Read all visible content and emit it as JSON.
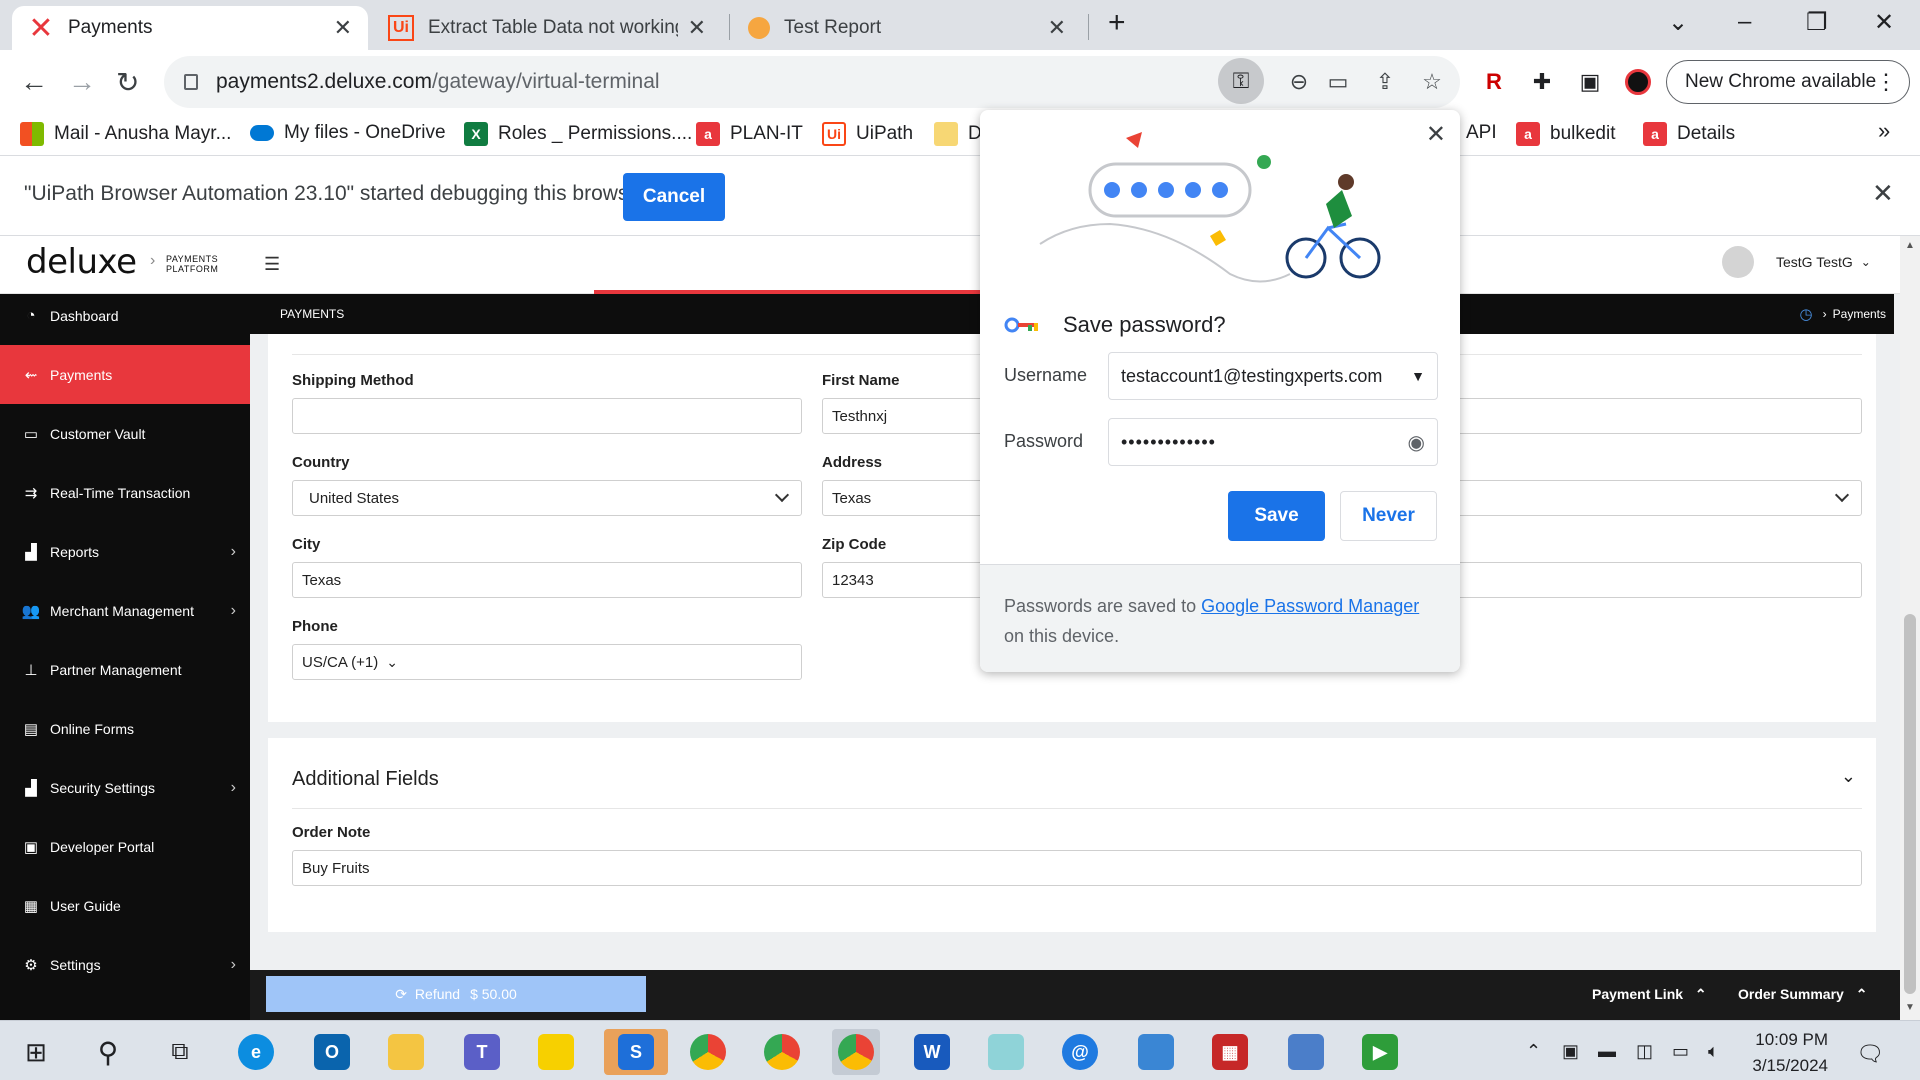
{
  "browser": {
    "tabs": [
      {
        "title": "Payments",
        "active": true
      },
      {
        "title": "Extract Table Data not working f",
        "active": false
      },
      {
        "title": "Test Report",
        "active": false
      }
    ],
    "url_host": "payments2.deluxe.com",
    "url_path": "/gateway/virtual-terminal",
    "new_chrome_label": "New Chrome available",
    "bookmarks": [
      {
        "label": "Mail - Anusha Mayr...",
        "color": "#f25022"
      },
      {
        "label": "My files - OneDrive",
        "color": "#0078d4"
      },
      {
        "label": "Roles _ Permissions....",
        "color": "#107c41"
      },
      {
        "label": "PLAN-IT",
        "color": "#e8373d"
      },
      {
        "label": "UiPath",
        "color": "#fa4616"
      },
      {
        "label": "D",
        "color": "#f7d774"
      },
      {
        "label": "API",
        "color": ""
      },
      {
        "label": "bulkedit",
        "color": "#e8373d"
      },
      {
        "label": "Details",
        "color": "#e8373d"
      }
    ],
    "infobar_message": "\"UiPath Browser Automation 23.10\" started debugging this browser",
    "infobar_cancel": "Cancel"
  },
  "app": {
    "logo": "deluxe",
    "logo_sub_1": "PAYMENTS",
    "logo_sub_2": "PLATFORM",
    "user_name": "TestG TestG",
    "section_label": "PAYMENTS",
    "crumb_right": "Payments",
    "sidebar": [
      {
        "label": "Dashboard",
        "icon": "dashboard-icon",
        "glyph": "◔",
        "active": false,
        "chevron": false
      },
      {
        "label": "Payments",
        "icon": "arrow-left-icon",
        "glyph": "⇜",
        "active": true,
        "chevron": false
      },
      {
        "label": "Customer Vault",
        "icon": "card-icon",
        "glyph": "▭",
        "active": false,
        "chevron": false
      },
      {
        "label": "Real-Time Transaction",
        "icon": "transaction-icon",
        "glyph": "⇉",
        "active": false,
        "chevron": false
      },
      {
        "label": "Reports",
        "icon": "bar-chart-icon",
        "glyph": "▟",
        "active": false,
        "chevron": true
      },
      {
        "label": "Merchant Management",
        "icon": "users-icon",
        "glyph": "👥",
        "active": false,
        "chevron": true
      },
      {
        "label": "Partner Management",
        "icon": "org-chart-icon",
        "glyph": "⊥",
        "active": false,
        "chevron": false
      },
      {
        "label": "Online Forms",
        "icon": "form-icon",
        "glyph": "▤",
        "active": false,
        "chevron": false
      },
      {
        "label": "Security Settings",
        "icon": "bar-chart-icon",
        "glyph": "▟",
        "active": false,
        "chevron": true
      },
      {
        "label": "Developer Portal",
        "icon": "code-icon",
        "glyph": "▣",
        "active": false,
        "chevron": false
      },
      {
        "label": "User Guide",
        "icon": "book-icon",
        "glyph": "▦",
        "active": false,
        "chevron": false
      },
      {
        "label": "Settings",
        "icon": "gear-icon",
        "glyph": "⚙",
        "active": false,
        "chevron": true
      }
    ],
    "form": {
      "shipping_method_label": "Shipping Method",
      "shipping_method_value": "",
      "first_name_label": "First Name",
      "first_name_value": "Testhnxj",
      "country_label": "Country",
      "country_value": "United States",
      "address_label": "Address",
      "address_value": "Texas",
      "city_label": "City",
      "city_value": "Texas",
      "zip_label": "Zip Code",
      "zip_value": "12343",
      "phone_label": "Phone",
      "phone_value": "US/CA (+1)"
    },
    "additional": {
      "title": "Additional Fields",
      "order_note_label": "Order Note",
      "order_note_value": "Buy Fruits"
    },
    "footer": {
      "refund_label": "Refund",
      "refund_amount": "$ 50.00",
      "payment_link": "Payment Link",
      "order_summary": "Order Summary"
    }
  },
  "password_popup": {
    "title": "Save password?",
    "username_label": "Username",
    "username_value": "testaccount1@testingxperts.com",
    "password_label": "Password",
    "password_value": "•••••••••••••",
    "save_label": "Save",
    "never_label": "Never",
    "footer_prefix": "Passwords are saved to",
    "footer_link": "Google Password Manager",
    "footer_suffix": "on this device."
  },
  "taskbar": {
    "time": "10:09 PM",
    "date": "3/15/2024"
  }
}
